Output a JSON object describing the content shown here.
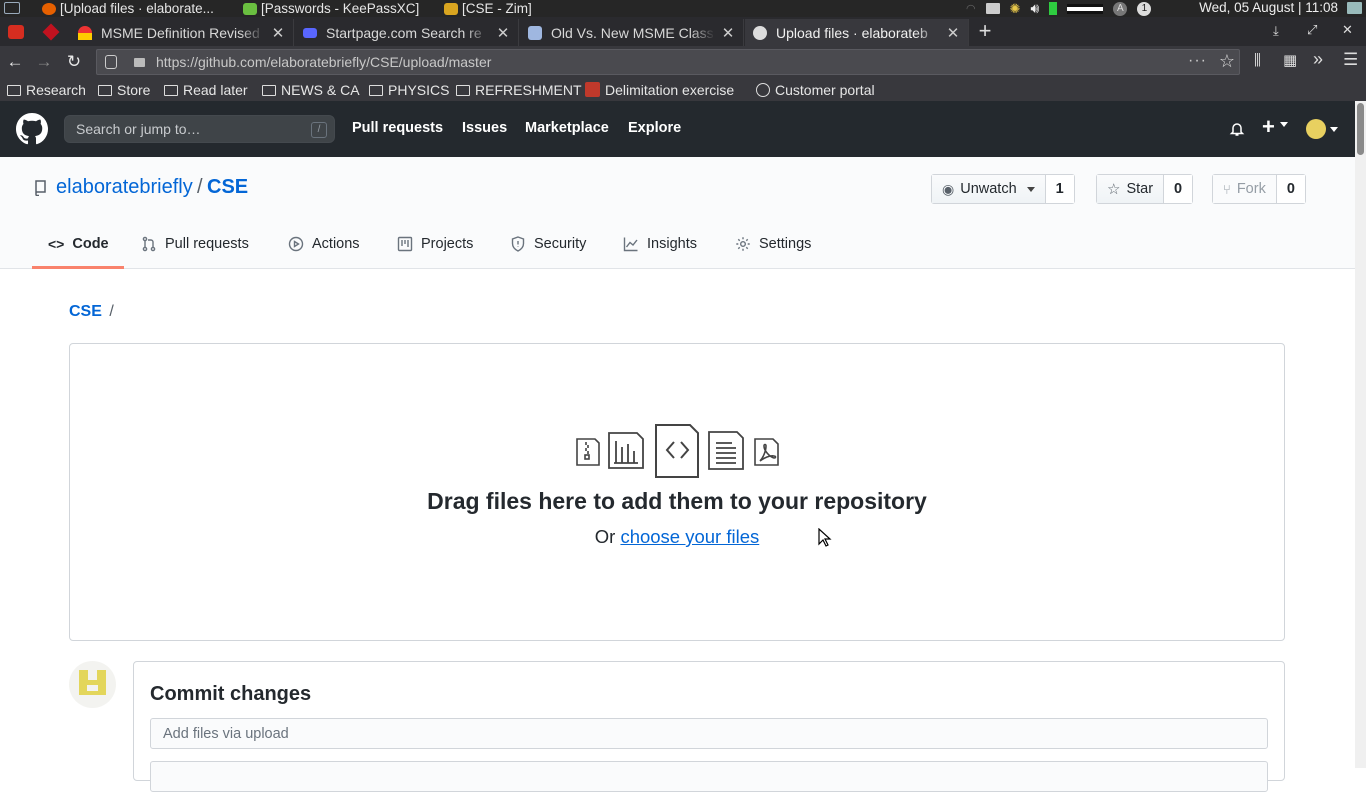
{
  "taskbar": {
    "tasks": [
      "[Upload files · elaborate...",
      "[Passwords - KeePassXC]",
      "[CSE - Zim]"
    ],
    "clock": "Wed, 05 August | 11:08"
  },
  "browser": {
    "tabs": [
      {
        "label": "MSME Definition Revised",
        "active": false
      },
      {
        "label": "Startpage.com Search re",
        "active": false
      },
      {
        "label": "Old Vs. New MSME Class",
        "active": false
      },
      {
        "label": "Upload files · elaborateb",
        "active": true
      }
    ],
    "url": "https://github.com/elaboratebriefly/CSE/upload/master",
    "bookmarks": [
      "Research",
      "Store",
      "Read later",
      "NEWS & CA",
      "PHYSICS",
      "REFRESHMENT",
      "Delimitation exercise",
      "Customer portal"
    ]
  },
  "github": {
    "search_placeholder": "Search or jump to…",
    "search_shortcut": "/",
    "nav": [
      "Pull requests",
      "Issues",
      "Marketplace",
      "Explore"
    ]
  },
  "repo": {
    "owner": "elaboratebriefly",
    "separator": "/",
    "name": "CSE",
    "watch_label": "Unwatch",
    "watch_count": "1",
    "star_label": "Star",
    "star_count": "0",
    "fork_label": "Fork",
    "fork_count": "0",
    "tabs": [
      "Code",
      "Pull requests",
      "Actions",
      "Projects",
      "Security",
      "Insights",
      "Settings"
    ]
  },
  "upload": {
    "breadcrumb_repo": "CSE",
    "breadcrumb_sep": "/",
    "headline": "Drag files here to add them to your repository",
    "or_text": "Or",
    "choose_link": "choose your files"
  },
  "commit": {
    "title": "Commit changes",
    "summary_placeholder": "Add files via upload"
  }
}
